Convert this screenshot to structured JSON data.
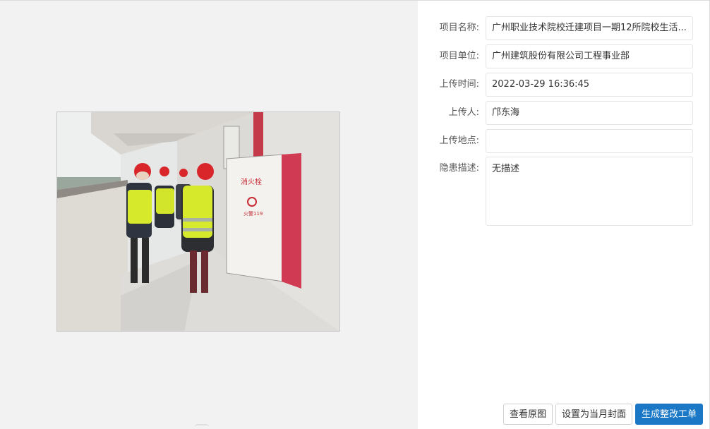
{
  "fields": [
    {
      "label": "项目名称:",
      "value": "广州职业技术院校迁建项目一期12所院校生活..."
    },
    {
      "label": "项目单位:",
      "value": "广州建筑股份有限公司工程事业部"
    },
    {
      "label": "上传时间:",
      "value": "2022-03-29 16:36:45"
    },
    {
      "label": "上传人:",
      "value": "邝东海"
    },
    {
      "label": "上传地点:",
      "value": ""
    },
    {
      "label": "隐患描述:",
      "value": "无描述"
    }
  ],
  "photo_signage": {
    "title": "消火栓",
    "line1": "火警119"
  },
  "buttons": {
    "view_original": "查看原图",
    "set_cover": "设置为当月封面",
    "generate_order": "生成整改工单"
  },
  "colors": {
    "primary": "#1a78c7",
    "left_bg": "#f2f2f2",
    "helmet_red": "#d8262b",
    "vest_yellow": "#d6e92a",
    "cabinet_red": "#d03a52"
  }
}
